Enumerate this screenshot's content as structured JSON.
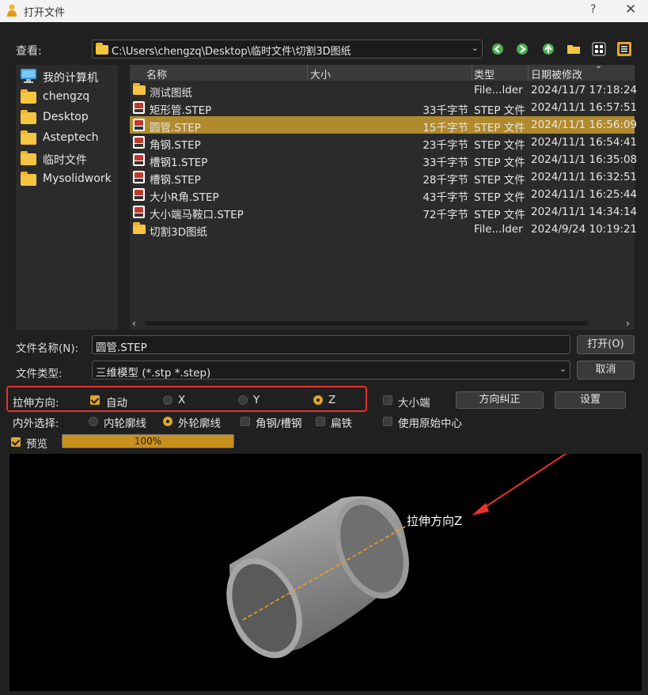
{
  "window": {
    "title": "打开文件",
    "help_glyph": "?",
    "close_glyph": "✕"
  },
  "location": {
    "label": "查看:",
    "path": "C:\\Users\\chengzq\\Desktop\\临时文件\\切割3D图纸"
  },
  "toolbar": {
    "back_icon": "back-arrow-icon",
    "forward_icon": "forward-arrow-icon",
    "up_icon": "up-arrow-icon",
    "new_folder_icon": "new-folder-icon",
    "icon_view_icon": "grid-view-icon",
    "detail_view_icon": "detail-view-icon"
  },
  "sidebar": {
    "items": [
      {
        "label": "我的计算机",
        "icon": "computer-icon"
      },
      {
        "label": "chengzq",
        "icon": "folder-icon"
      },
      {
        "label": "Desktop",
        "icon": "folder-icon"
      },
      {
        "label": "Asteptech",
        "icon": "folder-icon"
      },
      {
        "label": "临时文件",
        "icon": "folder-icon"
      },
      {
        "label": "Mysolidwork",
        "icon": "folder-icon"
      }
    ]
  },
  "file_list": {
    "columns": [
      "名称",
      "大小",
      "类型",
      "日期被修改"
    ],
    "rows": [
      {
        "name": "测试图纸",
        "size": "",
        "type": "File...lder",
        "date": "2024/11/7 17:18:24",
        "kind": "folder"
      },
      {
        "name": "矩形管.STEP",
        "size": "33千字节",
        "type": "STEP 文件",
        "date": "2024/11/1 16:57:51",
        "kind": "step"
      },
      {
        "name": "圆管.STEP",
        "size": "15千字节",
        "type": "STEP 文件",
        "date": "2024/11/1 16:56:09",
        "kind": "step"
      },
      {
        "name": "角钢.STEP",
        "size": "23千字节",
        "type": "STEP 文件",
        "date": "2024/11/1 16:54:41",
        "kind": "step"
      },
      {
        "name": "槽钢1.STEP",
        "size": "33千字节",
        "type": "STEP 文件",
        "date": "2024/11/1 16:35:08",
        "kind": "step"
      },
      {
        "name": "槽钢.STEP",
        "size": "28千字节",
        "type": "STEP 文件",
        "date": "2024/11/1 16:32:51",
        "kind": "step"
      },
      {
        "name": "大小R角.STEP",
        "size": "43千字节",
        "type": "STEP 文件",
        "date": "2024/11/1 16:25:44",
        "kind": "step"
      },
      {
        "name": "大小端马鞍口.STEP",
        "size": "72千字节",
        "type": "STEP 文件",
        "date": "2024/11/1 14:34:14",
        "kind": "step"
      },
      {
        "name": "切割3D图纸",
        "size": "",
        "type": "File...lder",
        "date": "2024/9/24 10:19:21",
        "kind": "folder"
      }
    ],
    "selected_index": 2
  },
  "filename": {
    "label": "文件名称(N):",
    "value": "圆管.STEP",
    "open_button": "打开(O)"
  },
  "filetype": {
    "label": "文件类型:",
    "value": "三维模型 (*.stp *.step)",
    "cancel_button": "取消"
  },
  "stretch": {
    "label": "拉伸方向:",
    "auto_label": "自动",
    "auto_checked": true,
    "x_label": "X",
    "y_label": "Y",
    "z_label": "Z",
    "selected": "Z",
    "big_small_label": "大小端",
    "big_small_checked": false,
    "correct_button": "方向纠正",
    "settings_button": "设置"
  },
  "inout": {
    "label": "内外选择:",
    "inner_label": "内轮廓线",
    "outer_label": "外轮廓线",
    "selected": "outer",
    "angle_channel_label": "角钢/槽钢",
    "angle_channel_checked": false,
    "flat_label": "扁铁",
    "flat_checked": false,
    "origin_center_label": "使用原始中心",
    "origin_center_checked": false
  },
  "preview": {
    "label": "预览",
    "checked": true,
    "progress_text": "100%",
    "progress_value": 1.0,
    "annotation": "拉伸方向Z"
  },
  "colors": {
    "accent": "#e0a62a",
    "selection": "#b08a2c",
    "annotation_red": "#e8322a",
    "axis_orange": "#f0a020"
  }
}
